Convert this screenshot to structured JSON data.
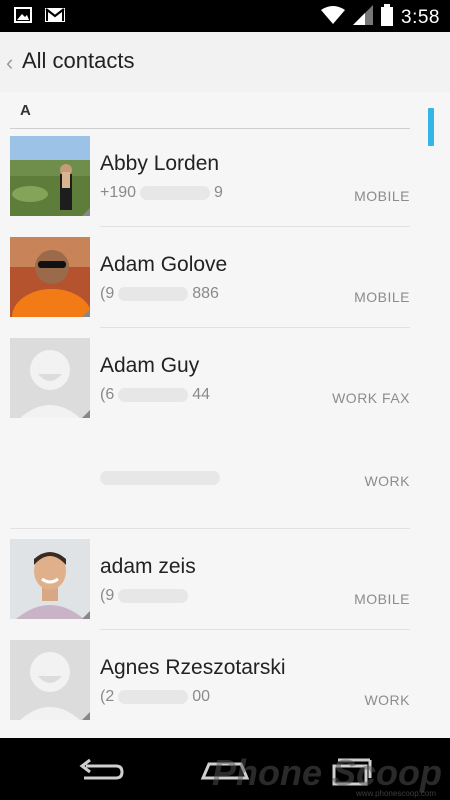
{
  "status_bar": {
    "time": "3:58",
    "icons": [
      "gallery-notification-icon",
      "gmail-notification-icon",
      "wifi-icon",
      "signal-icon",
      "battery-icon"
    ]
  },
  "action_bar": {
    "title": "All contacts",
    "up_icon": "chevron-left-icon"
  },
  "list": {
    "section": "A",
    "contacts": [
      {
        "name": "Abby Lorden",
        "phone_prefix": "+190",
        "phone_suffix": "9",
        "type": "MOBILE",
        "avatar": "photo-landscape"
      },
      {
        "name": "Adam Golove",
        "phone_prefix": "(9",
        "phone_suffix": "886",
        "type": "MOBILE",
        "avatar": "photo-man-sunglasses"
      },
      {
        "name": "Adam Guy",
        "phone_prefix": "(6",
        "phone_suffix": "44",
        "type": "WORK FAX",
        "avatar": "default-avatar"
      },
      {
        "name": "",
        "phone_prefix": "",
        "phone_suffix": "",
        "type": "WORK",
        "avatar": ""
      },
      {
        "name": "adam zeis",
        "phone_prefix": "(9",
        "phone_suffix": "",
        "type": "MOBILE",
        "avatar": "photo-man-smiling"
      },
      {
        "name": "Agnes Rzeszotarski",
        "phone_prefix": "(2",
        "phone_suffix": "00",
        "type": "WORK",
        "avatar": "default-avatar"
      }
    ]
  },
  "nav_bar": {
    "buttons": [
      "back-icon",
      "home-icon",
      "recent-apps-icon"
    ]
  },
  "watermark": {
    "text": "Phone Scoop",
    "subtext": "www.phonescoop.com"
  },
  "colors": {
    "accent": "#33b5e5",
    "background": "#f2f2f2",
    "bars": "#000000"
  }
}
